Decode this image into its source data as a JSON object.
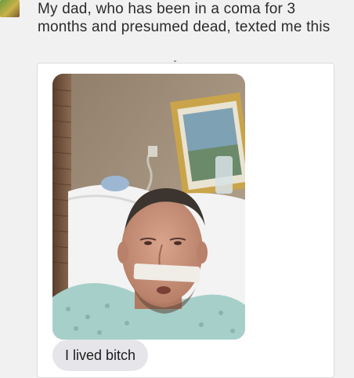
{
  "post": {
    "text": "My dad, who has been in a coma for 3 months and presumed dead, texted me this",
    "avatar_icon": "user-avatar"
  },
  "message": {
    "image_icon": "hospital-selfie-photo",
    "bubble_text": "I lived bitch",
    "bubble_color": "#e5e5ea"
  }
}
